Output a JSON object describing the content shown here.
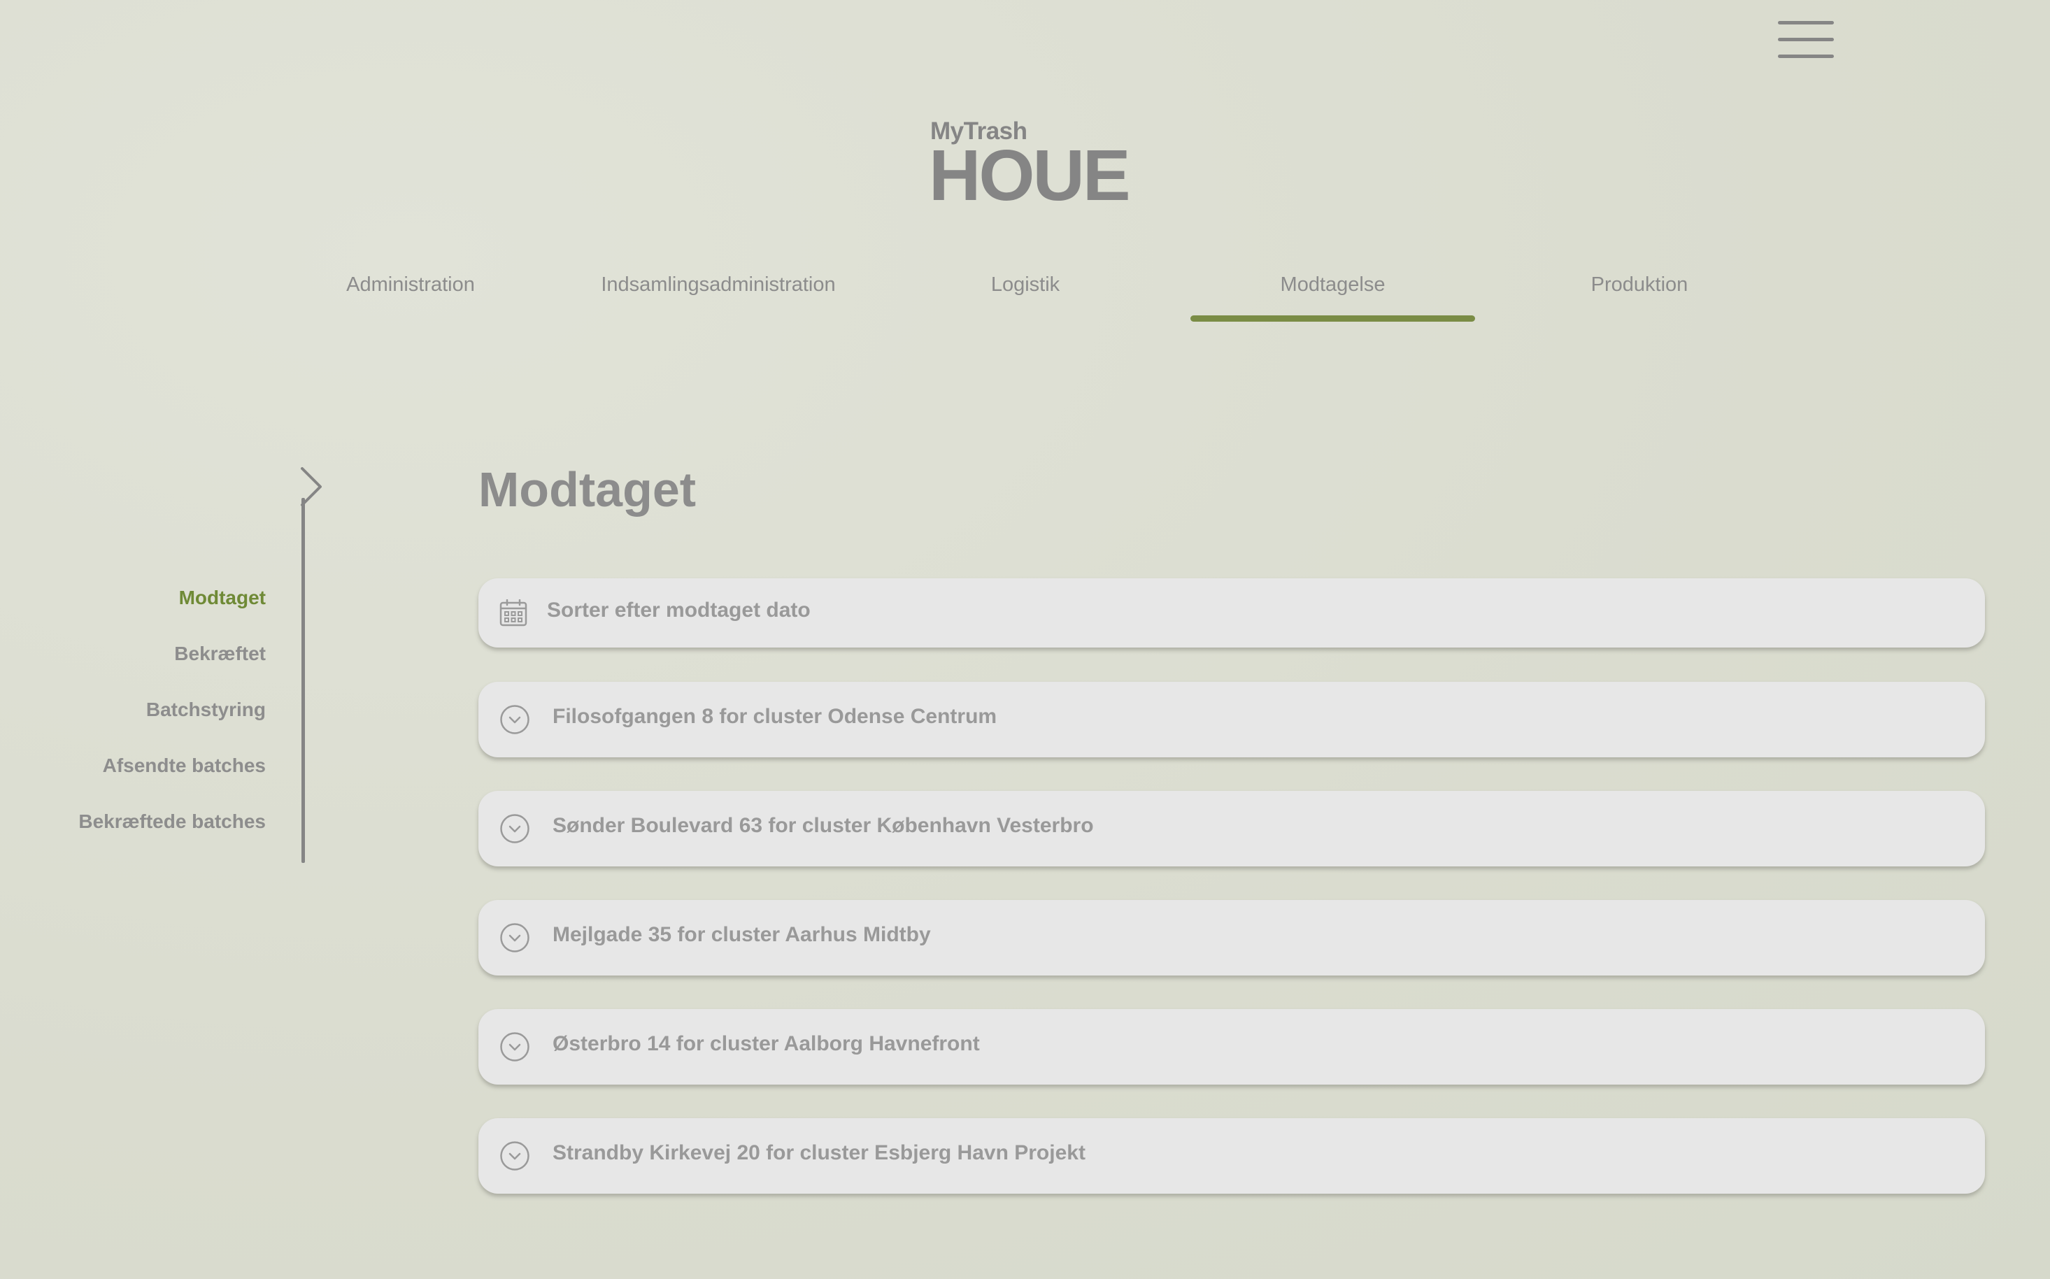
{
  "header": {
    "menu_icon": "hamburger-menu-icon",
    "logo_small": "MyTrash",
    "logo_big": "HOUE"
  },
  "top_nav": {
    "tabs": [
      {
        "label": "Administration",
        "active": false
      },
      {
        "label": "Indsamlingsadministration",
        "active": false
      },
      {
        "label": "Logistik",
        "active": false
      },
      {
        "label": "Modtagelse",
        "active": true
      },
      {
        "label": "Produktion",
        "active": false
      }
    ]
  },
  "side_nav": {
    "icon": "chevron-right-icon",
    "items": [
      {
        "label": "Modtaget",
        "active": true
      },
      {
        "label": "Bekræftet",
        "active": false
      },
      {
        "label": "Batchstyring",
        "active": false
      },
      {
        "label": "Afsendte batches",
        "active": false
      },
      {
        "label": "Bekræftede batches",
        "active": false
      }
    ]
  },
  "main": {
    "title": "Modtaget",
    "sort": {
      "icon": "calendar-icon",
      "label": "Sorter efter modtaget dato"
    },
    "items": [
      {
        "label": "Filosofgangen 8 for cluster Odense Centrum",
        "icon": "chevron-down-circle-icon"
      },
      {
        "label": "Sønder Boulevard 63 for cluster København Vesterbro",
        "icon": "chevron-down-circle-icon"
      },
      {
        "label": "Mejlgade 35 for cluster Aarhus Midtby",
        "icon": "chevron-down-circle-icon"
      },
      {
        "label": "Østerbro 14 for cluster Aalborg Havnefront",
        "icon": "chevron-down-circle-icon"
      },
      {
        "label": "Strandby Kirkevej 20 for cluster Esbjerg Havn Projekt",
        "icon": "chevron-down-circle-icon"
      }
    ]
  },
  "colors": {
    "accent": "#7a8c45",
    "active_text": "#6f8a36",
    "background": "#dcdfd2",
    "card": "#e7e7e7",
    "text": "#8c8c8c"
  }
}
